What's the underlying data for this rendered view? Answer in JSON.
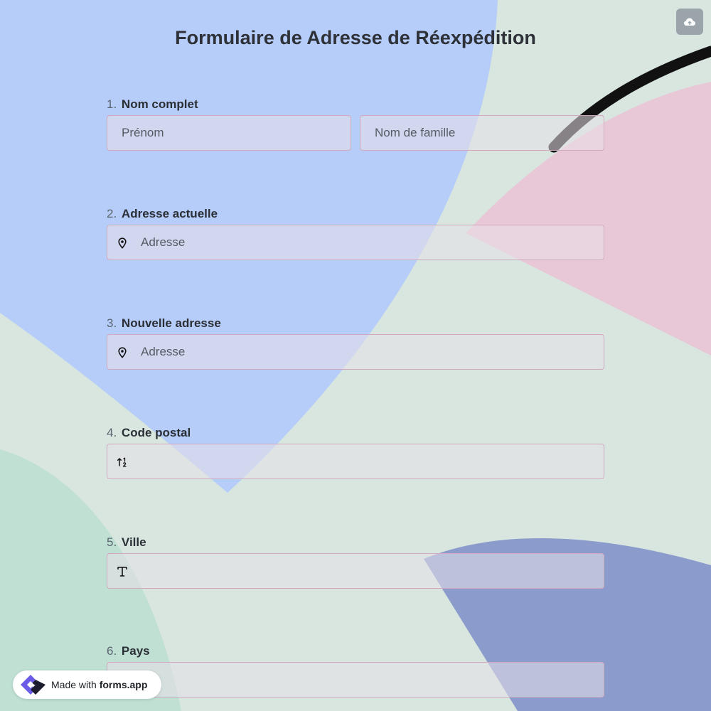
{
  "form": {
    "title": "Formulaire de Adresse de Réexpédition",
    "questions": [
      {
        "number": "1.",
        "label": "Nom complet",
        "placeholder_first": "Prénom",
        "placeholder_last": "Nom de famille",
        "value_first": "",
        "value_last": ""
      },
      {
        "number": "2.",
        "label": "Adresse actuelle",
        "placeholder": "Adresse",
        "value": "",
        "icon": "location-pin-icon"
      },
      {
        "number": "3.",
        "label": "Nouvelle adresse",
        "placeholder": "Adresse",
        "value": "",
        "icon": "location-pin-icon"
      },
      {
        "number": "4.",
        "label": "Code postal",
        "placeholder": "",
        "value": "",
        "icon": "number-sort-icon"
      },
      {
        "number": "5.",
        "label": "Ville",
        "placeholder": "",
        "value": "",
        "icon": "text-type-icon"
      },
      {
        "number": "6.",
        "label": "Pays",
        "placeholder": "",
        "value": ""
      }
    ]
  },
  "toolbar": {
    "cloud_icon": "cloud-upload-icon"
  },
  "badge": {
    "prefix": "Made with",
    "brand": "forms.app",
    "logo": "forms-app-logo-icon"
  },
  "colors": {
    "background": "#d8e6df",
    "blue_shape": "#b5cdf8",
    "pink_shape": "#e8c8d6",
    "navy_shape": "#8a9bcc",
    "mint_shape": "#bfe0d3",
    "field_border": "#cfa9bd",
    "title": "#2e3238"
  }
}
